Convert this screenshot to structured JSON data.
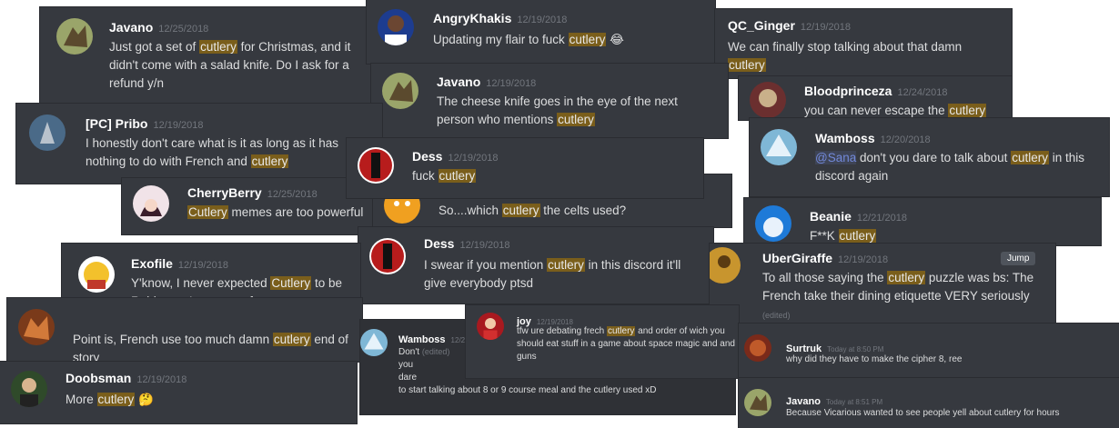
{
  "messages": [
    {
      "name": "Javano",
      "ts": "12/25/2018",
      "pre": "Just got a set of ",
      "hl": "cutlery",
      "post": " for Christmas, and it didn't come with a salad knife. Do I ask for a refund y/n"
    },
    {
      "name": "AngryKhakis",
      "ts": "12/19/2018",
      "pre": "Updating my flair to fuck ",
      "hl": "cutlery",
      "post": " ",
      "emoji": "😂"
    },
    {
      "name": "QC_Ginger",
      "ts": "12/19/2018",
      "pre": "We can finally stop talking about that damn ",
      "hl": "cutlery",
      "post": ""
    },
    {
      "name": "Javano",
      "ts": "12/19/2018",
      "pre": "The cheese knife goes in the eye of the next person who mentions ",
      "hl": "cutlery",
      "post": ""
    },
    {
      "name": "Bloodprinceza",
      "ts": "12/24/2018",
      "pre": "you can never escape the ",
      "hl": "cutlery",
      "post": ""
    },
    {
      "name": "[PC] Pribo",
      "ts": "12/19/2018",
      "pre": "I honestly don't care what is it as long as it has nothing to do with French and ",
      "hl": "cutlery",
      "post": ""
    },
    {
      "name": "Dess",
      "ts": "12/19/2018",
      "pre": "fuck ",
      "hl": "cutlery",
      "post": ""
    },
    {
      "name": "Wamboss",
      "ts": "12/20/2018",
      "mention": "@Sana",
      "pre": " don't you dare to talk about ",
      "hl": "cutlery",
      "post": " in this discord again"
    },
    {
      "name": "CherryBerry",
      "ts": "12/25/2018",
      "pre": "",
      "hl": "Cutlery",
      "post": " memes are too powerful"
    },
    {
      "name": "",
      "ts": "",
      "pre": "So....which ",
      "hl": "cutlery",
      "post": " the celts used?"
    },
    {
      "name": "Beanie",
      "ts": "12/21/2018",
      "pre": "F**K ",
      "hl": "cutlery",
      "post": ""
    },
    {
      "name": "Dess",
      "ts": "12/19/2018",
      "pre": "I swear if you mention ",
      "hl": "cutlery",
      "post": " in this discord it'll give everybody ptsd"
    },
    {
      "name": "UberGiraffe",
      "ts": "12/19/2018",
      "pre": "To all those saying the ",
      "hl": "cutlery",
      "post": " puzzle was bs: The French take their dining etiquette VERY seriously",
      "edited": "(edited)",
      "jump": "Jump"
    },
    {
      "name": "Exofile",
      "ts": "12/19/2018",
      "pre": "Y'know, I never expected ",
      "hl": "Cutlery",
      "post": " to be Raidsecret's greatest foe."
    },
    {
      "name": "",
      "ts": "",
      "pre": "Point is, French use too much damn ",
      "hl": "cutlery",
      "post": " end of story"
    },
    {
      "name": "joy",
      "ts": "12/19/2018",
      "pre": "tfw ure debating frech ",
      "hl": "cutlery",
      "post": " and order of wich you should eat stuff in a game about space magic and and guns"
    },
    {
      "name": "Wamboss",
      "ts": "12/2...",
      "lines": [
        "Don't",
        "you",
        "dare",
        "to start talking about 8 or 9 course meal and the cutlery used xD"
      ],
      "edited": "(edited)"
    },
    {
      "name": "Surtruk",
      "ts": "Today at 8:50 PM",
      "pre": "why did they have to make the cipher 8, ree",
      "hl": "",
      "post": ""
    },
    {
      "name": "Doobsman",
      "ts": "12/19/2018",
      "pre": "More ",
      "hl": "cutlery",
      "post": " ",
      "emoji": "🤔"
    },
    {
      "name": "Javano",
      "ts": "Today at 8:51 PM",
      "pre": "Because Vicarious wanted to see people yell about cutlery for hours",
      "hl": "",
      "post": ""
    }
  ]
}
